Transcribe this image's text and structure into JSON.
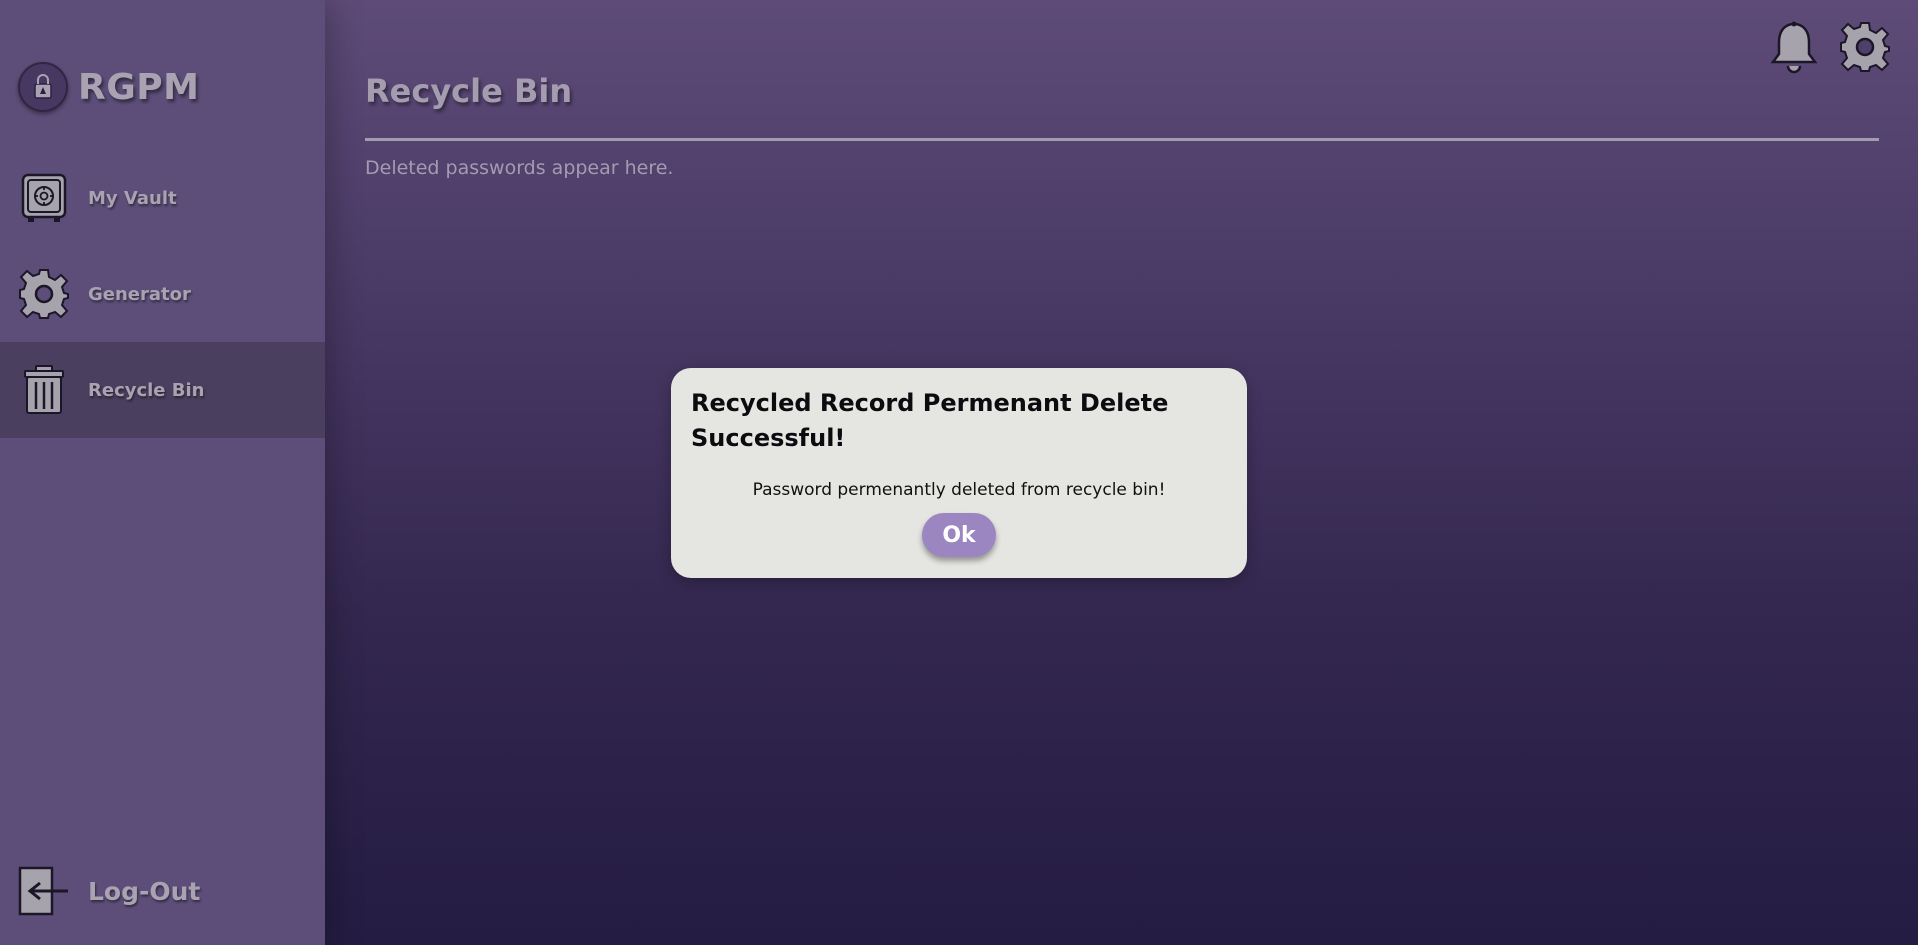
{
  "app": {
    "brand": "RGPM"
  },
  "sidebar": {
    "items": [
      {
        "label": "My Vault",
        "icon": "vault-icon"
      },
      {
        "label": "Generator",
        "icon": "gear-icon"
      },
      {
        "label": "Recycle Bin",
        "icon": "trash-icon",
        "active": true
      }
    ],
    "logout_label": "Log-Out"
  },
  "main": {
    "title": "Recycle Bin",
    "description": "Deleted passwords appear here."
  },
  "topbar": {
    "icons": [
      "bell-icon",
      "settings-gear-icon"
    ]
  },
  "modal": {
    "title": "Recycled Record Permenant Delete Successful!",
    "message": "Password permenantly deleted from recycle bin!",
    "ok_label": "Ok"
  },
  "colors": {
    "sidebar_bg": "#5c4e78",
    "active_item_bg": "#4a3f5e",
    "modal_bg": "#e5e5e1",
    "ok_button": "#9c86c2"
  }
}
